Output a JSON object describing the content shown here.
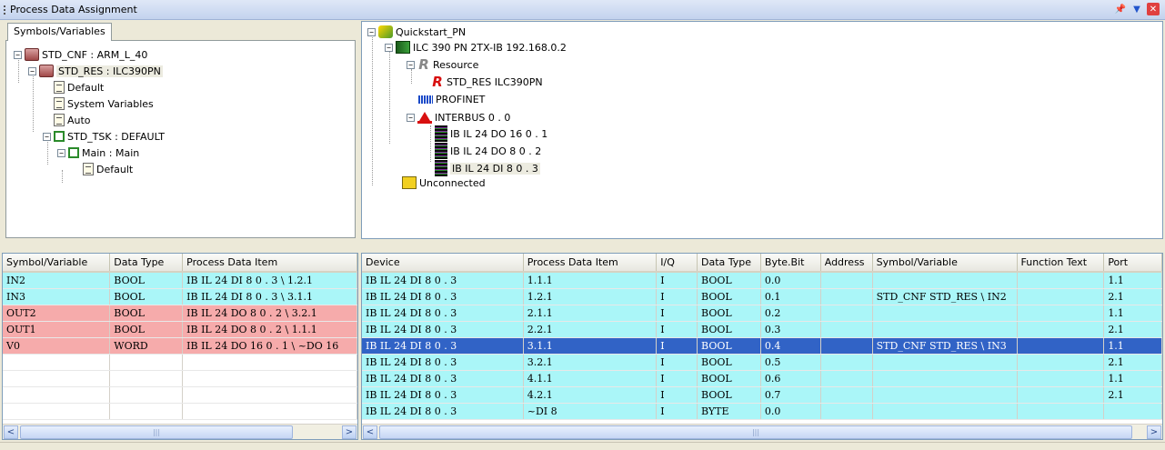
{
  "window": {
    "title": "Process Data Assignment"
  },
  "left_tree": {
    "tab_label": "Symbols/Variables",
    "nodes": [
      "STD_CNF : ARM_L_40",
      "STD_RES : ILC390PN",
      "Default",
      "System Variables",
      "Auto",
      "STD_TSK : DEFAULT",
      "Main : Main",
      "Default"
    ]
  },
  "right_tree": {
    "nodes": [
      "Quickstart_PN",
      "ILC 390 PN 2TX-IB 192.168.0.2",
      "Resource",
      "STD_RES ILC390PN",
      "PROFINET",
      "INTERBUS 0 . 0",
      "IB IL 24 DO 16 0 . 1",
      "IB IL 24 DO 8 0 . 2",
      "IB IL 24 DI 8 0 . 3",
      "Unconnected"
    ]
  },
  "left_grid": {
    "headers": [
      "Symbol/Variable",
      "Data Type",
      "Process Data Item"
    ],
    "rows": [
      [
        "IN2",
        "BOOL",
        "IB IL 24 DI 8 0 . 3 \\ 1.2.1"
      ],
      [
        "IN3",
        "BOOL",
        "IB IL 24 DI 8 0 . 3 \\ 3.1.1"
      ],
      [
        "OUT2",
        "BOOL",
        "IB IL 24 DO 8 0 . 2 \\ 3.2.1"
      ],
      [
        "OUT1",
        "BOOL",
        "IB IL 24 DO 8 0 . 2 \\ 1.1.1"
      ],
      [
        "V0",
        "WORD",
        "IB IL 24 DO 16 0 . 1 \\ ~DO 16"
      ]
    ],
    "row_colors": [
      "cyan",
      "cyan",
      "pink",
      "pink",
      "pink"
    ]
  },
  "right_grid": {
    "headers": [
      "Device",
      "Process Data Item",
      "I/Q",
      "Data Type",
      "Byte.Bit",
      "Address",
      "Symbol/Variable",
      "Function Text",
      "Port"
    ],
    "rows": [
      [
        "IB IL 24 DI 8 0 . 3",
        "1.1.1",
        "I",
        "BOOL",
        "0.0",
        "",
        "",
        "",
        "1.1"
      ],
      [
        "IB IL 24 DI 8 0 . 3",
        "1.2.1",
        "I",
        "BOOL",
        "0.1",
        "",
        "STD_CNF STD_RES \\ IN2",
        "",
        "2.1"
      ],
      [
        "IB IL 24 DI 8 0 . 3",
        "2.1.1",
        "I",
        "BOOL",
        "0.2",
        "",
        "",
        "",
        "1.1"
      ],
      [
        "IB IL 24 DI 8 0 . 3",
        "2.2.1",
        "I",
        "BOOL",
        "0.3",
        "",
        "",
        "",
        "2.1"
      ],
      [
        "IB IL 24 DI 8 0 . 3",
        "3.1.1",
        "I",
        "BOOL",
        "0.4",
        "",
        "STD_CNF STD_RES \\ IN3",
        "",
        "1.1"
      ],
      [
        "IB IL 24 DI 8 0 . 3",
        "3.2.1",
        "I",
        "BOOL",
        "0.5",
        "",
        "",
        "",
        "2.1"
      ],
      [
        "IB IL 24 DI 8 0 . 3",
        "4.1.1",
        "I",
        "BOOL",
        "0.6",
        "",
        "",
        "",
        "1.1"
      ],
      [
        "IB IL 24 DI 8 0 . 3",
        "4.2.1",
        "I",
        "BOOL",
        "0.7",
        "",
        "",
        "",
        "2.1"
      ],
      [
        "IB IL 24 DI 8 0 . 3",
        "~DI 8",
        "I",
        "BYTE",
        "0.0",
        "",
        "",
        "",
        ""
      ]
    ],
    "selected_row": 4
  },
  "colors": {
    "cyan_row": "#aaf6f8",
    "pink_row": "#f6abab",
    "selection": "#3163c6"
  },
  "icons": [
    "pin-icon",
    "dropdown-icon",
    "close-icon",
    "scroll-left-icon",
    "scroll-right-icon"
  ]
}
